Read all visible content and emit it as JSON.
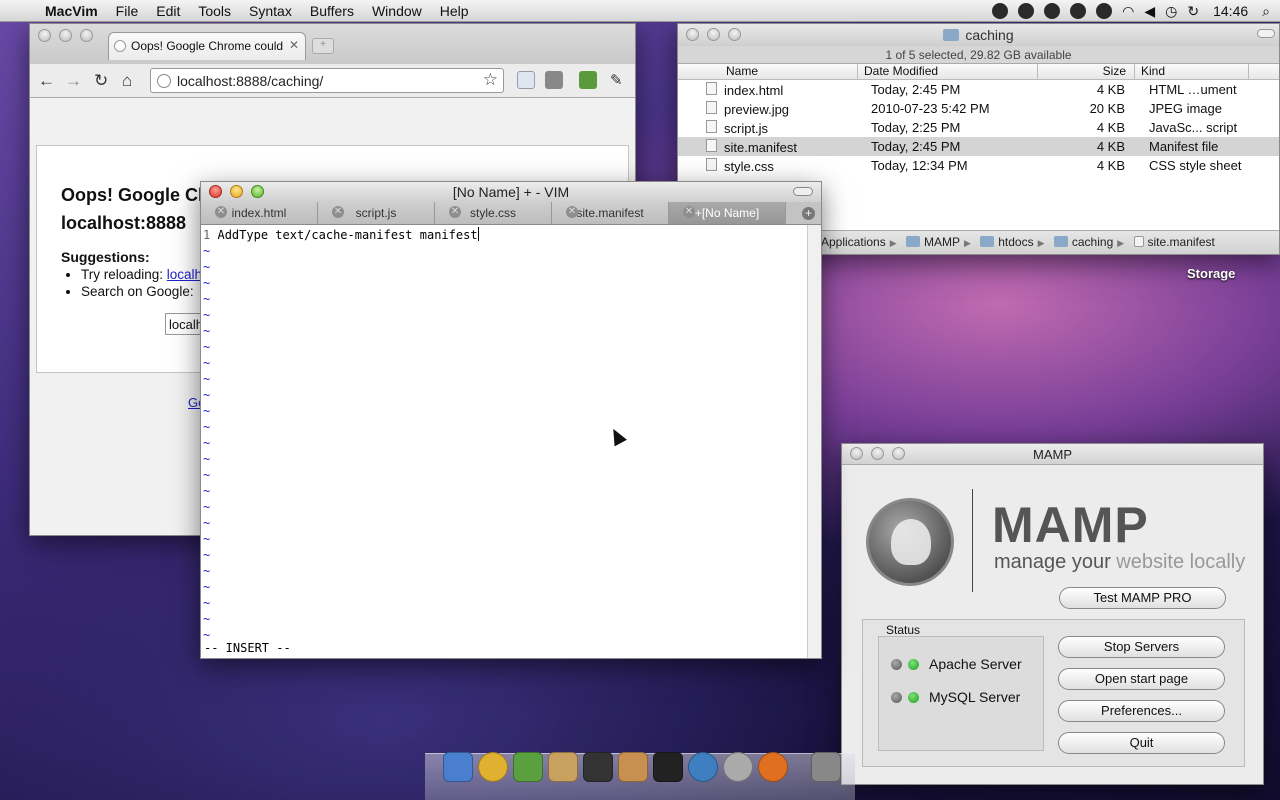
{
  "menubar": {
    "app": "MacVim",
    "items": [
      "File",
      "Edit",
      "Tools",
      "Syntax",
      "Buffers",
      "Window",
      "Help"
    ],
    "clock": "14:46",
    "status_icons": [
      "dropbox-icon",
      "creative-cloud-icon",
      "mute-icon",
      "vlc-icon",
      "q-icon",
      "wifi-icon",
      "volume-icon",
      "time-machine-icon",
      "sync-icon",
      "spotlight-icon"
    ]
  },
  "chrome": {
    "tab_title": "Oops! Google Chrome could",
    "url": "localhost:8888/caching/",
    "heading1": "Oops! Google Cl",
    "heading2": "localhost:8888",
    "suggestions_label": "Suggestions:",
    "bullet1_prefix": "Try reloading: ",
    "bullet1_link": "localho",
    "bullet2": "Search on Google:",
    "search_value": "localh",
    "footer_link": "Go"
  },
  "finder": {
    "title": "caching",
    "status": "1 of 5 selected, 29.82 GB available",
    "columns": [
      "Name",
      "Date Modified",
      "Size",
      "Kind"
    ],
    "files": [
      {
        "name": "index.html",
        "date": "Today, 2:45 PM",
        "size": "4 KB",
        "kind": "HTML …ument",
        "icon": "html-file-icon"
      },
      {
        "name": "preview.jpg",
        "date": "2010-07-23 5:42 PM",
        "size": "20 KB",
        "kind": "JPEG image",
        "icon": "jpeg-file-icon"
      },
      {
        "name": "script.js",
        "date": "Today, 2:25 PM",
        "size": "4 KB",
        "kind": "JavaSc... script",
        "icon": "js-file-icon"
      },
      {
        "name": "site.manifest",
        "date": "Today, 2:45 PM",
        "size": "4 KB",
        "kind": "Manifest file",
        "icon": "manifest-file-icon"
      },
      {
        "name": "style.css",
        "date": "Today, 12:34 PM",
        "size": "4 KB",
        "kind": "CSS style sheet",
        "icon": "css-file-icon"
      }
    ],
    "path": [
      "Applications",
      "MAMP",
      "htdocs",
      "caching",
      "site.manifest"
    ]
  },
  "desktop": {
    "storage_label": "Storage"
  },
  "vim": {
    "title": "[No Name] + - VIM",
    "tabs": [
      "index.html",
      "script.js",
      "style.css",
      "site.manifest",
      "+[No Name]"
    ],
    "line_number": "1",
    "line_text": "AddType text/cache-manifest manifest",
    "mode": "-- INSERT --",
    "tilde": "~"
  },
  "mamp": {
    "title": "MAMP",
    "brand": "MAMP",
    "tagline_a": "manage your ",
    "tagline_b": "website locally",
    "test_pro": "Test MAMP PRO",
    "status_label": "Status",
    "apache": "Apache Server",
    "mysql": "MySQL Server",
    "stop": "Stop Servers",
    "open_start": "Open start page",
    "prefs": "Preferences...",
    "quit": "Quit"
  },
  "dock": {
    "items": [
      "finder-icon",
      "chrome-icon",
      "scrivener-icon",
      "script-editor-icon",
      "tv-icon",
      "transmit-icon",
      "terminal-icon",
      "ical-icon",
      "mamp-icon",
      "firefox-icon",
      "trash-icon"
    ]
  }
}
